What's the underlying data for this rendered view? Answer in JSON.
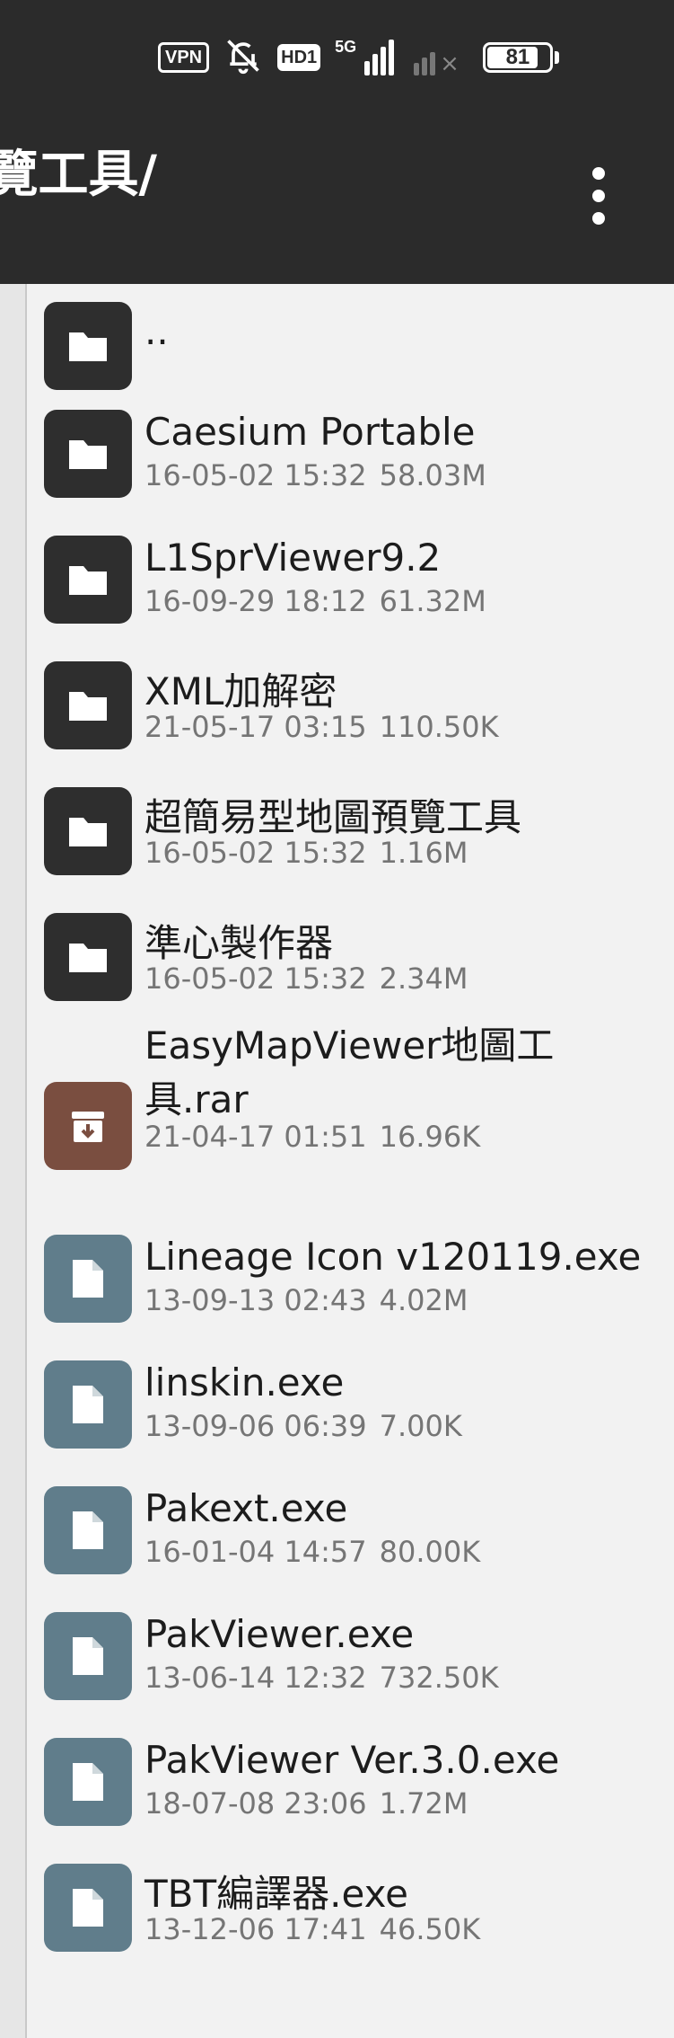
{
  "status_bar": {
    "vpn_label": "VPN",
    "hd_label": "HD1",
    "network_label": "5G",
    "battery_level": "81"
  },
  "header": {
    "title": "超簡易型地圖預覽工具/",
    "menu_icon": "more-vertical-icon"
  },
  "colors": {
    "toolbar_bg": "#2b2b2b",
    "folder_icon_bg": "#2e2e2e",
    "archive_icon_bg": "#7a4e40",
    "file_icon_bg": "#607d8b"
  },
  "files": [
    {
      "name": "..",
      "type": "folder",
      "date": "",
      "size": ""
    },
    {
      "name": "Caesium Portable",
      "type": "folder",
      "date": "16-05-02 15:32",
      "size": "58.03M"
    },
    {
      "name": "L1SprViewer9.2",
      "type": "folder",
      "date": "16-09-29 18:12",
      "size": "61.32M"
    },
    {
      "name": "XML加解密",
      "type": "folder",
      "date": "21-05-17 03:15",
      "size": "110.50K"
    },
    {
      "name": "超簡易型地圖預覽工具",
      "type": "folder",
      "date": "16-05-02 15:32",
      "size": "1.16M"
    },
    {
      "name": "準心製作器",
      "type": "folder",
      "date": "16-05-02 15:32",
      "size": "2.34M"
    },
    {
      "name_line1": "EasyMapViewer地圖工",
      "name_line2": "具.rar",
      "type": "archive",
      "date": "21-04-17 01:51",
      "size": "16.96K"
    },
    {
      "name": "Lineage Icon v120119.exe",
      "type": "file",
      "date": "13-09-13 02:43",
      "size": "4.02M"
    },
    {
      "name": "linskin.exe",
      "type": "file",
      "date": "13-09-06 06:39",
      "size": "7.00K"
    },
    {
      "name": "Pakext.exe",
      "type": "file",
      "date": "16-01-04 14:57",
      "size": "80.00K"
    },
    {
      "name": "PakViewer.exe",
      "type": "file",
      "date": "13-06-14 12:32",
      "size": "732.50K"
    },
    {
      "name": "PakViewer Ver.3.0.exe",
      "type": "file",
      "date": "18-07-08 23:06",
      "size": "1.72M"
    },
    {
      "name": "TBT編譯器.exe",
      "type": "file",
      "date": "13-12-06 17:41",
      "size": "46.50K"
    }
  ]
}
